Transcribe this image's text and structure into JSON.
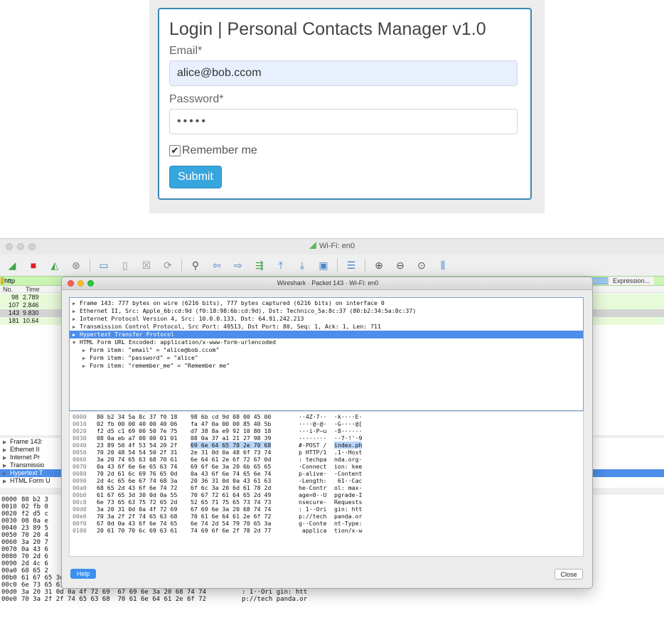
{
  "login": {
    "title": "Login | Personal Contacts Manager v1.0",
    "email_label": "Email*",
    "email_value": "alice@bob.ccom",
    "password_label": "Password*",
    "password_value": "•••••",
    "remember_label": "Remember me",
    "remember_checked": true,
    "submit_label": "Submit"
  },
  "wireshark_main": {
    "window_title": "Wi-Fi: en0",
    "filter_text": "http",
    "expression_label": "Expression...",
    "columns": [
      "No.",
      "Time"
    ],
    "rows": [
      {
        "no": "98",
        "time": "2.789"
      },
      {
        "no": "107",
        "time": "2.846"
      },
      {
        "no": "143",
        "time": "9.830"
      },
      {
        "no": "181",
        "time": "10.64"
      }
    ],
    "detail_rows": [
      "Frame 143:",
      "Ethernet II",
      "Internet Pr",
      "Transmissio",
      "Hypertext T",
      "HTML Form U"
    ],
    "bytes_rows": [
      {
        "off": "0000",
        "hex": "80 b2 3",
        "ascii": ""
      },
      {
        "off": "0010",
        "hex": "02 fb 0",
        "ascii": ""
      },
      {
        "off": "0020",
        "hex": "f2 d5 c",
        "ascii": ""
      },
      {
        "off": "0030",
        "hex": "08 0a e",
        "ascii": ""
      },
      {
        "off": "0040",
        "hex": "23 89 5",
        "ascii": ""
      },
      {
        "off": "0050",
        "hex": "70 20 4",
        "ascii": ""
      },
      {
        "off": "0060",
        "hex": "3a 20 7",
        "ascii": ""
      },
      {
        "off": "0070",
        "hex": "0a 43 6",
        "ascii": ""
      },
      {
        "off": "0080",
        "hex": "70 2d 6",
        "ascii": ""
      },
      {
        "off": "0090",
        "hex": "2d 4c 6",
        "ascii": ""
      },
      {
        "off": "00a0",
        "hex": "68 65 2",
        "ascii": ""
      },
      {
        "off": "00b0",
        "hex": "61 67 65 3d 30 0d 0a 55  70 67 72 61 64 65 2d 49",
        "ascii": "age=0··U pgrade-I"
      },
      {
        "off": "00c0",
        "hex": "6e 73 65 63 75 72 65 2d  52 65 71 75 65 73 74 73",
        "ascii": "nsecure- Requests"
      },
      {
        "off": "00d0",
        "hex": "3a 20 31 0d 0a 4f 72 69  67 69 6e 3a 20 68 74 74",
        "ascii": ": 1··Ori gin: htt"
      },
      {
        "off": "00e0",
        "hex": "70 3a 2f 2f 74 65 63 68  70 61 6e 64 61 2e 6f 72",
        "ascii": "p://tech panda.or"
      }
    ]
  },
  "dialog": {
    "title": "Wireshark · Packet 143 · Wi-Fi: en0",
    "tree": [
      {
        "text": "Frame 143: 777 bytes on wire (6216 bits), 777 bytes captured (6216 bits) on interface 0",
        "indent": 0,
        "expanded": false,
        "selected": false
      },
      {
        "text": "Ethernet II, Src: Apple_6b:cd:9d (f0:18:98:6b:cd:9d), Dst: Technico_5a:8c:37 (80:b2:34:5a:8c:37)",
        "indent": 0,
        "expanded": false,
        "selected": false
      },
      {
        "text": "Internet Protocol Version 4, Src: 10.0.0.133, Dst: 64.91.242.213",
        "indent": 0,
        "expanded": false,
        "selected": false
      },
      {
        "text": "Transmission Control Protocol, Src Port: 49513, Dst Port: 80, Seq: 1, Ack: 1, Len: 711",
        "indent": 0,
        "expanded": false,
        "selected": false
      },
      {
        "text": "Hypertext Transfer Protocol",
        "indent": 0,
        "expanded": false,
        "selected": true
      },
      {
        "text": "HTML Form URL Encoded: application/x-www-form-urlencoded",
        "indent": 0,
        "expanded": true,
        "selected": false
      },
      {
        "text": "Form item: \"email\" = \"alice@bob.ccom\"",
        "indent": 1,
        "expanded": false,
        "selected": false
      },
      {
        "text": "Form item: \"password\" = \"alice\"",
        "indent": 1,
        "expanded": false,
        "selected": false
      },
      {
        "text": "Form item: \"remember_me\" = \"Remember me\"",
        "indent": 1,
        "expanded": false,
        "selected": false
      }
    ],
    "bytes": [
      {
        "off": "0000",
        "h1": "80 b2 34 5a 8c 37 f0 18",
        "h2": "98 6b cd 9d 08 00 45 00",
        "a1": "··4Z·7··",
        "a2": "·k····E·"
      },
      {
        "off": "0010",
        "h1": "02 fb 00 00 40 00 40 06",
        "h2": "fa 47 0a 00 00 85 40 5b",
        "a1": "····@·@·",
        "a2": "·G····@["
      },
      {
        "off": "0020",
        "h1": "f2 d5 c1 69 00 50 7e 75",
        "h2": "d7 38 8a e9 92 10 80 18",
        "a1": "···i·P~u",
        "a2": "·8······"
      },
      {
        "off": "0030",
        "h1": "08 0a eb a7 00 00 01 01",
        "h2": "08 0a 37 a1 21 27 98 39",
        "a1": "········",
        "a2": "··7·!'·9"
      },
      {
        "off": "0040",
        "h1": "23 89 50 4f 53 54 20 2f",
        "h2": "69 6e 64 65 78 2e 70 68",
        "a1": "#·POST /",
        "a2": "index.ph"
      },
      {
        "off": "0050",
        "h1": "70 20 48 54 54 50 2f 31",
        "h2": "2e 31 0d 0a 48 6f 73 74",
        "a1": "p HTTP/1",
        "a2": ".1··Host"
      },
      {
        "off": "0060",
        "h1": "3a 20 74 65 63 68 70 61",
        "h2": "6e 64 61 2e 6f 72 67 0d",
        "a1": ": techpa",
        "a2": "nda.org·"
      },
      {
        "off": "0070",
        "h1": "0a 43 6f 6e 6e 65 63 74",
        "h2": "69 6f 6e 3a 20 6b 65 65",
        "a1": "·Connect",
        "a2": "ion: kee"
      },
      {
        "off": "0080",
        "h1": "70 2d 61 6c 69 76 65 0d",
        "h2": "0a 43 6f 6e 74 65 6e 74",
        "a1": "p-alive·",
        "a2": "·Content"
      },
      {
        "off": "0090",
        "h1": "2d 4c 65 6e 67 74 68 3a",
        "h2": "20 36 31 0d 0a 43 61 63",
        "a1": "-Length:",
        "a2": " 61··Cac"
      },
      {
        "off": "00a0",
        "h1": "68 65 2d 43 6f 6e 74 72",
        "h2": "6f 6c 3a 20 6d 61 78 2d",
        "a1": "he-Contr",
        "a2": "ol: max-"
      },
      {
        "off": "00b0",
        "h1": "61 67 65 3d 30 0d 0a 55",
        "h2": "70 67 72 61 64 65 2d 49",
        "a1": "age=0··U",
        "a2": "pgrade-I"
      },
      {
        "off": "00c0",
        "h1": "6e 73 65 63 75 72 65 2d",
        "h2": "52 65 71 75 65 73 74 73",
        "a1": "nsecure-",
        "a2": "Requests"
      },
      {
        "off": "00d0",
        "h1": "3a 20 31 0d 0a 4f 72 69",
        "h2": "67 69 6e 3a 20 68 74 74",
        "a1": ": 1··Ori",
        "a2": "gin: htt"
      },
      {
        "off": "00e0",
        "h1": "70 3a 2f 2f 74 65 63 68",
        "h2": "70 61 6e 64 61 2e 6f 72",
        "a1": "p://tech",
        "a2": "panda.or"
      },
      {
        "off": "00f0",
        "h1": "67 0d 0a 43 6f 6e 74 65",
        "h2": "6e 74 2d 54 79 70 65 3a",
        "a1": "g··Conte",
        "a2": "nt-Type:"
      },
      {
        "off": "0100",
        "h1": "20 61 70 70 6c 69 63 61",
        "h2": "74 69 6f 6e 2f 78 2d 77",
        "a1": " applica",
        "a2": "tion/x-w"
      }
    ],
    "help_label": "Help",
    "close_label": "Close"
  },
  "colors": {
    "accent_blue": "#4c8eea",
    "filter_green": "#c9f4b4",
    "submit_blue": "#37a6de"
  }
}
